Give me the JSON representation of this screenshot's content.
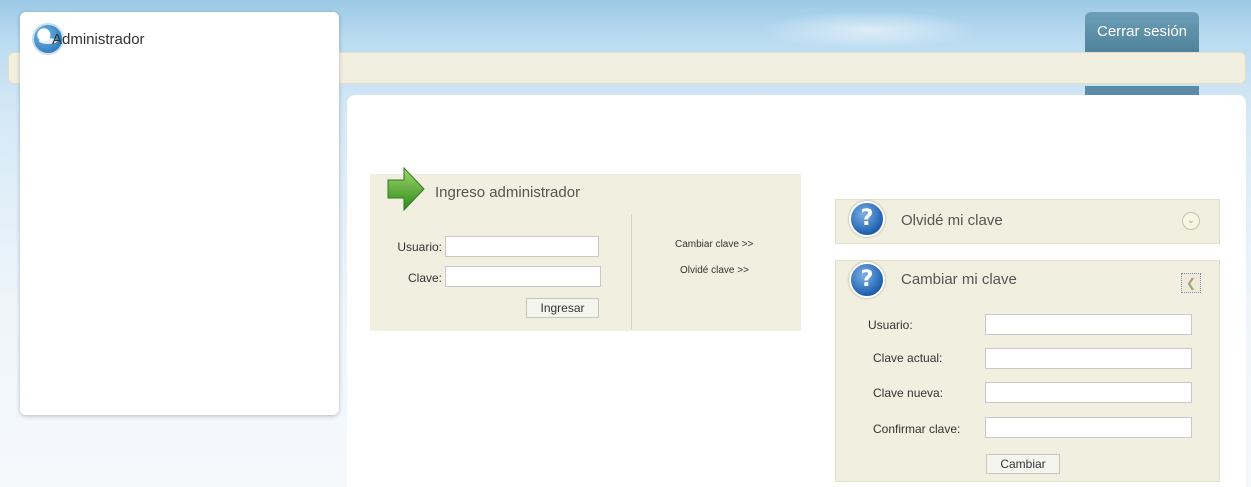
{
  "header": {
    "logout_label": "Cerrar sesión"
  },
  "sidebar": {
    "title": "Administrador"
  },
  "login": {
    "title": "Ingreso administrador",
    "user_label": "Usuario:",
    "user_value": "",
    "password_label": "Clave:",
    "password_value": "",
    "submit_label": "Ingresar",
    "change_link": "Cambiar clave >>",
    "forgot_link": "Olvidé clave >>"
  },
  "forgot_panel": {
    "title": "Olvidé mi clave",
    "icon": "question-icon",
    "toggle_icon": "chevron-down-icon"
  },
  "change_panel": {
    "title": "Cambiar mi clave",
    "icon": "question-icon",
    "toggle_icon": "chevron-left-icon",
    "fields": [
      {
        "label": "Usuario:",
        "value": ""
      },
      {
        "label": "Clave actual:",
        "value": ""
      },
      {
        "label": "Clave nueva:",
        "value": ""
      },
      {
        "label": "Confirmar clave:",
        "value": ""
      }
    ],
    "submit_label": "Cambiar"
  },
  "colors": {
    "panel_bg": "#f1efdf",
    "accent_blue": "#1f5fae",
    "logout_bg": "#5c8ca5"
  }
}
